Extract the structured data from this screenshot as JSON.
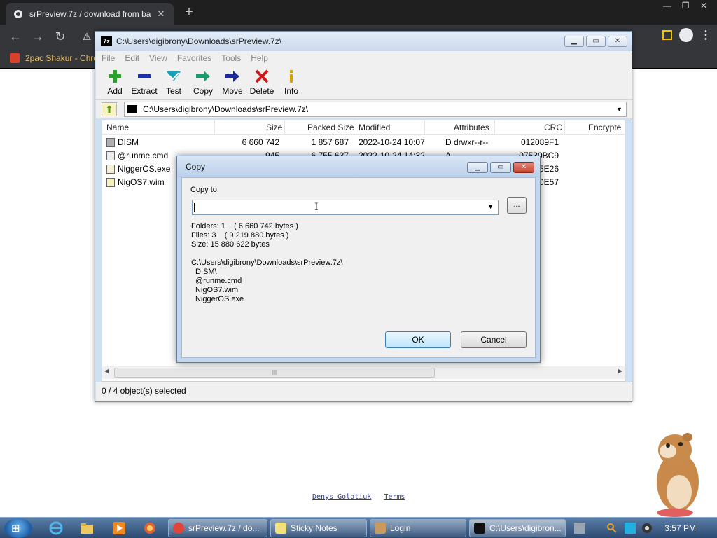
{
  "browser": {
    "tab_title": "srPreview.7z / download from ba",
    "tab_close": "✕",
    "new_tab": "+",
    "bookmark_label": "2pac Shakur - Chro"
  },
  "page": {
    "footer_links": [
      "Denys Golotiuk",
      "Terms"
    ]
  },
  "sevenzip": {
    "title": "C:\\Users\\digibrony\\Downloads\\srPreview.7z\\",
    "app_icon_text": "7z",
    "menu": [
      "File",
      "Edit",
      "View",
      "Favorites",
      "Tools",
      "Help"
    ],
    "toolbar": [
      {
        "label": "Add",
        "icon": "plus-icon",
        "color": "#2ea02e"
      },
      {
        "label": "Extract",
        "icon": "minus-icon",
        "color": "#1a30a8"
      },
      {
        "label": "Test",
        "icon": "check-icon",
        "color": "#1aa0b8"
      },
      {
        "label": "Copy",
        "icon": "copy-arrow-icon",
        "color": "#1a9a6a"
      },
      {
        "label": "Move",
        "icon": "move-arrow-icon",
        "color": "#1a2a9a"
      },
      {
        "label": "Delete",
        "icon": "delete-x-icon",
        "color": "#d01818"
      },
      {
        "label": "Info",
        "icon": "info-icon",
        "color": "#d8a000"
      }
    ],
    "address": "C:\\Users\\digibrony\\Downloads\\srPreview.7z\\",
    "columns": [
      "Name",
      "Size",
      "Packed Size",
      "Modified",
      "Attributes",
      "CRC",
      "Encrypte"
    ],
    "rows": [
      {
        "name": "DISM",
        "size": "6 660 742",
        "packed": "1 857 687",
        "modified": "2022-10-24 10:07",
        "attributes": "D drwxr--r--",
        "crc": "012089F1"
      },
      {
        "name": "@runme.cmd",
        "size": "945",
        "packed": "6 755 637",
        "modified": "2022-10-24 14:32",
        "attributes": "A",
        "crc": "07530BC9"
      },
      {
        "name": "NiggerOS.exe",
        "size": "",
        "packed": "",
        "modified": "",
        "attributes": "",
        "crc": "05E26"
      },
      {
        "name": "NigOS7.wim",
        "size": "",
        "packed": "",
        "modified": "",
        "attributes": "",
        "crc": "90E57"
      }
    ],
    "status": "0 / 4 object(s) selected"
  },
  "copy_dialog": {
    "title": "Copy",
    "copy_to_label": "Copy to:",
    "copy_to_value": "",
    "browse_label": "...",
    "info": {
      "folders": "Folders: 1    ( 6 660 742 bytes )",
      "files": "Files: 3    ( 9 219 880 bytes )",
      "size": "Size: 15 880 622 bytes",
      "path": "C:\\Users\\digibrony\\Downloads\\srPreview.7z\\",
      "items": [
        "DISM\\",
        "@runme.cmd",
        "NigOS7.wim",
        "NiggerOS.exe"
      ]
    },
    "ok_label": "OK",
    "cancel_label": "Cancel"
  },
  "taskbar": {
    "tasks": [
      {
        "label": "srPreview.7z / do...",
        "icon_color": "#e0443a"
      },
      {
        "label": "Sticky Notes",
        "icon_color": "#f3e27a"
      },
      {
        "label": "Login",
        "icon_color": "#c89a60"
      },
      {
        "label": "C:\\Users\\digibron...",
        "icon_color": "#111111"
      }
    ],
    "clock": "3:57 PM"
  }
}
